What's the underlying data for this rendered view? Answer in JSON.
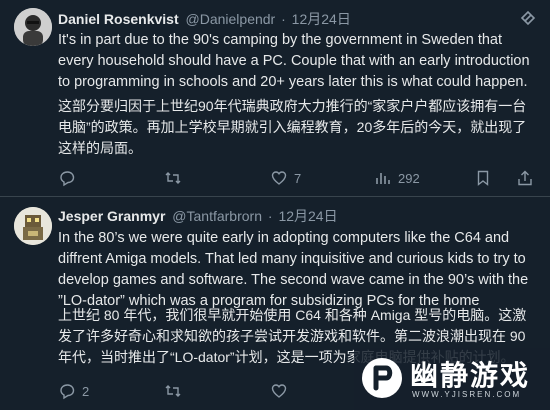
{
  "tweets": [
    {
      "name": "Daniel Rosenkvist",
      "handle": "@Danielpendr",
      "separator": "·",
      "date": "12月24日",
      "text_en": "It's in part due to the 90's camping by the government in Sweden that every household should have a PC. Couple that with an early introduction to programming in schools and 20+ years later this is what could happen.",
      "text_zh": "这部分要归因于上世纪90年代瑞典政府大力推行的“家家户户都应该拥有一台电脑”的政策。再加上学校早期就引入编程教育，20多年后的今天，就出现了这样的局面。",
      "actions": {
        "reply": "",
        "retweet": "",
        "like": "7",
        "views": "292"
      },
      "avatar_icon": "person-avatar"
    },
    {
      "name": "Jesper Granmyr",
      "handle": "@Tantfarbrorn",
      "separator": "·",
      "date": "12月24日",
      "text_en": "In the 80’s we were quite early in adopting computers like the C64 and diffrent Amiga models. That led many inquisitive and curious kids to try to develop games and software. The second wave came in the 90’s with the ”LO-dator” which was a program for subsidizing PCs for the home",
      "text_zh": "上世纪 80 年代，我们很早就开始使用 C64 和各种 Amiga 型号的电脑。这激发了许多好奇心和求知欲的孩子尝试开发游戏和软件。第二波浪潮出现在 90 年代，当时推出了“LO-dator”计划，这是一项为家庭电脑提供补贴的计划。",
      "actions": {
        "reply": "2",
        "retweet": "",
        "like": "",
        "views": ""
      },
      "avatar_icon": "robot-avatar"
    }
  ],
  "watermark": {
    "text": "幽静游戏",
    "url": "WWW.YJISREN.COM"
  },
  "colors": {
    "background": "#15202b",
    "text": "#e7e9ea",
    "muted": "#8b98a5",
    "divider": "#38444d"
  }
}
